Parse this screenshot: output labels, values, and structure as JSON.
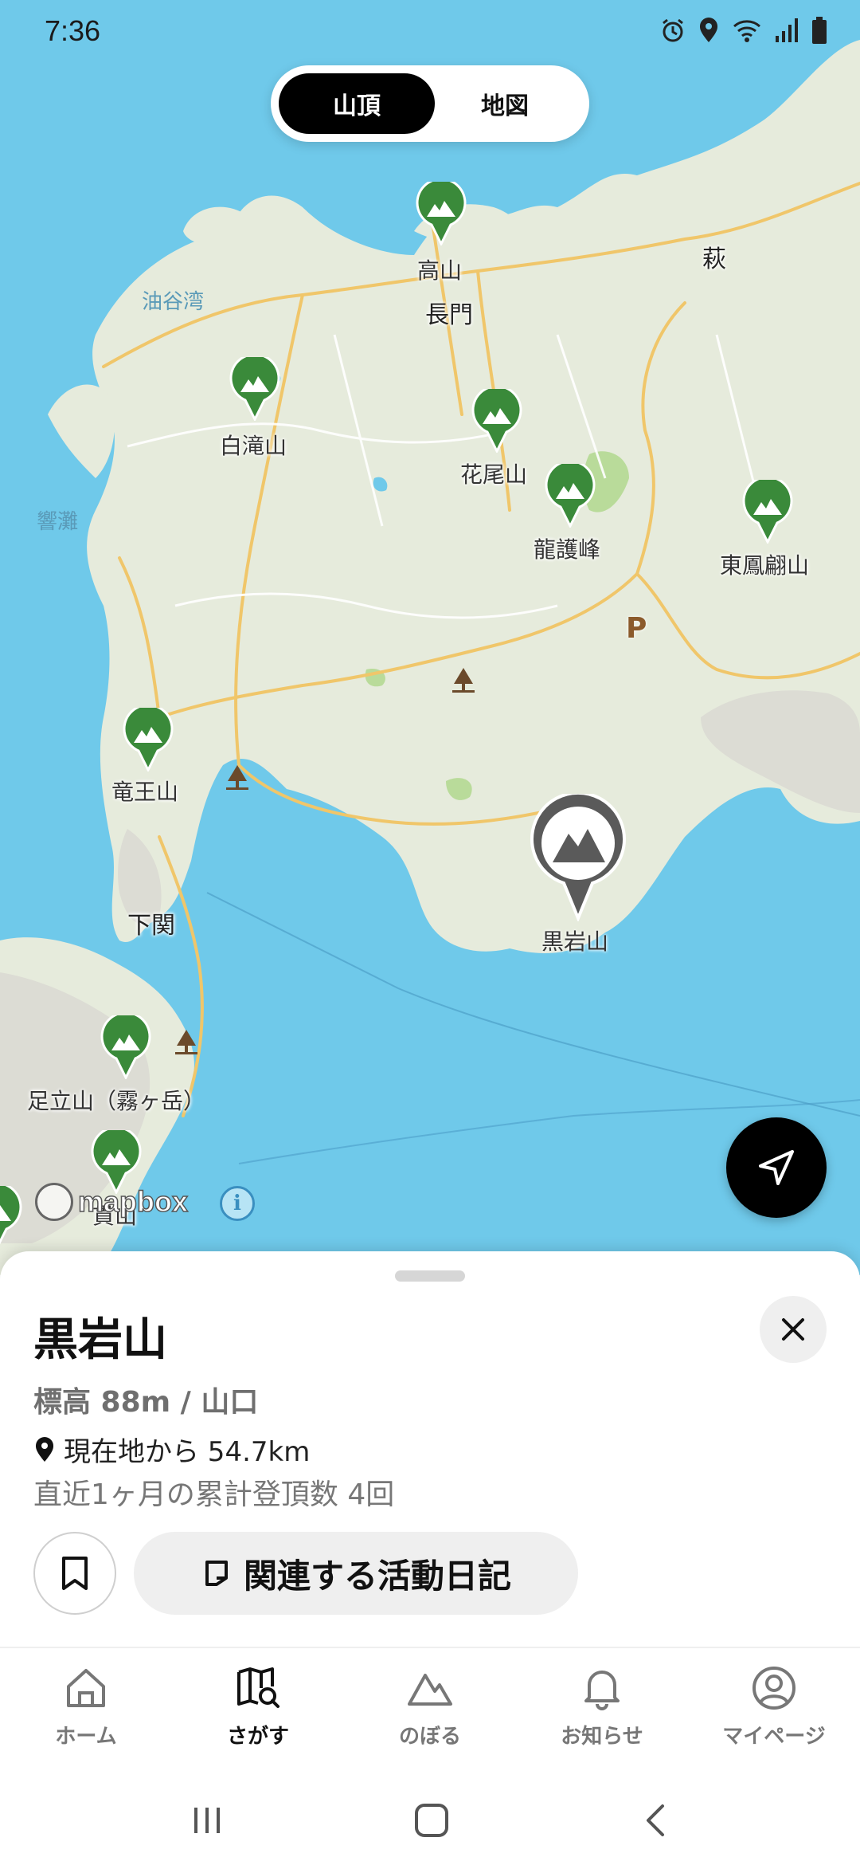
{
  "status_bar": {
    "time": "7:36",
    "icons": [
      "alarm-icon",
      "location-icon",
      "wifi-icon",
      "signal-icon",
      "battery-icon"
    ]
  },
  "toggle": {
    "active_label": "山頂",
    "inactive_label": "地図"
  },
  "map": {
    "place_labels": {
      "nagato": "長門",
      "hagi": "萩",
      "yuyawan": "油谷湾",
      "hibikinada": "響灘",
      "shimonoseki": "下関"
    },
    "peaks": {
      "takayama": "高山",
      "shirotakiyama": "白滝山",
      "hanaoyama": "花尾山",
      "ryugomine": "龍護峰",
      "higashihoushouzan": "東鳳翩山",
      "ryuouzan": "竜王山",
      "adachiyama": "足立山（霧ヶ岳）",
      "nukiyama": "貫山"
    },
    "selected_peak": "黒岩山",
    "parking_label": "P",
    "attribution": "mapbox",
    "info_label": "i"
  },
  "sheet": {
    "title": "黒岩山",
    "elevation": "標高 88m / 山口",
    "distance": "現在地から 54.7km",
    "climbs": "直近1ヶ月の累計登頂数 4回",
    "diary_button": "関連する活動日記"
  },
  "bottom_nav": {
    "home": "ホーム",
    "search": "さがす",
    "climb": "のぼる",
    "notifications": "お知らせ",
    "mypage": "マイページ"
  },
  "colors": {
    "sea": "#6fc9ea",
    "land": "#e6ebdc",
    "peak_pin": "#3a8a3a",
    "selected_pin": "#5a5a5a",
    "road": "#f0c66a"
  }
}
